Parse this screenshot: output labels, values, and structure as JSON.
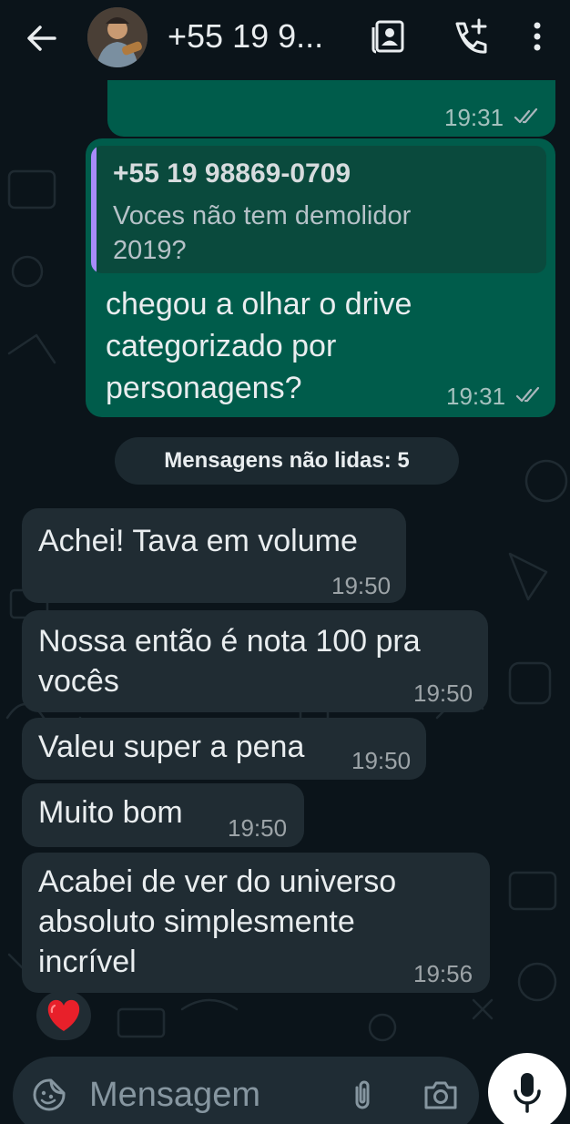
{
  "header": {
    "contact_name": "+55 19 9...",
    "icons": [
      "back-arrow-icon",
      "avatar",
      "contact-card-icon",
      "add-call-icon",
      "more-vert-icon"
    ]
  },
  "messages": [
    {
      "direction": "outgoing",
      "text": "",
      "time": "19:31",
      "status": "read"
    },
    {
      "direction": "outgoing",
      "reply_to": {
        "author": "+55 19 98869-0709",
        "text_lines": [
          "Voces não tem demolidor",
          "2019?"
        ]
      },
      "text_lines": [
        "chegou a olhar o drive",
        "categorizado por",
        "personagens?"
      ],
      "time": "19:31",
      "status": "read"
    },
    {
      "direction": "incoming",
      "text_lines": [
        "Achei! Tava em volume"
      ],
      "time": "19:50"
    },
    {
      "direction": "incoming",
      "text_lines": [
        "Nossa então é nota 100 pra",
        "vocês"
      ],
      "time": "19:50"
    },
    {
      "direction": "incoming",
      "text_lines": [
        "Valeu super a pena"
      ],
      "time": "19:50"
    },
    {
      "direction": "incoming",
      "text_lines": [
        "Muito bom"
      ],
      "time": "19:50"
    },
    {
      "direction": "incoming",
      "text_lines": [
        "Acabei de ver do universo",
        "absoluto simplesmente",
        "incrível"
      ],
      "time": "19:56",
      "reaction": "❤️"
    }
  ],
  "unread_divider": "Mensagens não lidas: 5",
  "composer": {
    "placeholder": "Mensagem",
    "icons": [
      "sticker-icon",
      "attach-icon",
      "camera-icon",
      "mic-icon"
    ]
  },
  "colors": {
    "background": "#0b141a",
    "outgoing_bubble": "#005c4b",
    "incoming_bubble": "#202c33",
    "quote_bar": "#a78bfa",
    "reaction_heart": "#e8202a"
  }
}
